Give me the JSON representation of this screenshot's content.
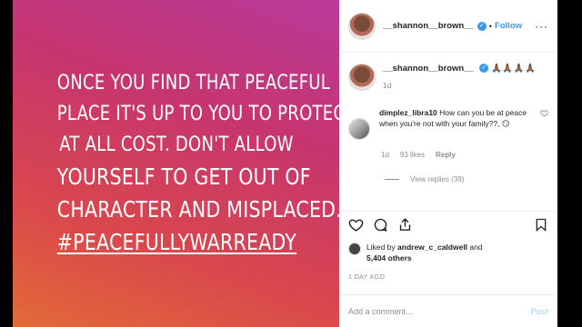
{
  "post": {
    "quote_lines": [
      "ONCE YOU FIND THAT PEACEFUL",
      "PLACE IT'S UP TO YOU TO PROTECT IT",
      "AT ALL COST. DON'T ALLOW",
      "YOURSELF TO GET OUT OF",
      "CHARACTER AND MISPLACED."
    ],
    "hashtag": "#PEACEFULLYWARREADY"
  },
  "header": {
    "username": "__shannon__brown__",
    "verified_mark": "✓",
    "separator": "•",
    "follow_label": "Follow",
    "more_icon": "···"
  },
  "caption": {
    "username": "__shannon__brown__",
    "emoji": "🙏🏾🙏🏾🙏🏾🙏🏾",
    "age": "1d"
  },
  "comment": {
    "username": "dimplez_libra10",
    "text": "How can you be at peace when you're not with your family??,",
    "emoji": "😏",
    "age": "1d",
    "likes": "93 likes",
    "reply_label": "Reply",
    "view_replies": "View replies (39)"
  },
  "likes": {
    "prefix": "Liked by ",
    "user": "andrew_c_caldwell",
    "and": " and",
    "others": "5,404 others"
  },
  "timestamp": "1 DAY AGO",
  "comment_box": {
    "placeholder": "Add a comment...",
    "post_label": "Post"
  },
  "colors": {
    "accent": "#3897f0",
    "gradient_top": "#b83a9a",
    "gradient_bottom": "#e36a38"
  }
}
